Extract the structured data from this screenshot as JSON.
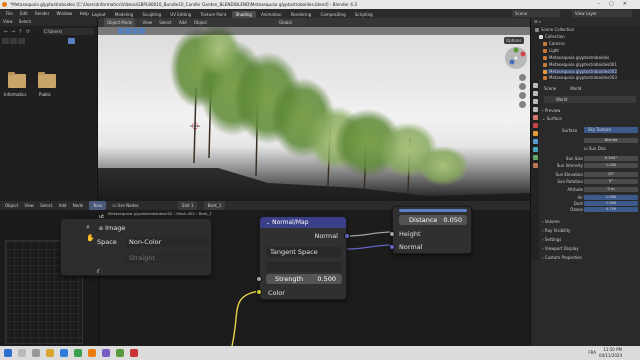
{
  "window": {
    "title": "*Metasequoia glyptostroboides [C:\\Users\\Informatics\\Videos\\GBPL80010_Bundle10_Conifer Garden_BLEND\\BLEND\\Metasequoia glyptostroboides.blend] - Blender 4.3"
  },
  "menubar": {
    "items": [
      "File",
      "Edit",
      "Render",
      "Window",
      "Help"
    ],
    "workspaces": [
      "Layout",
      "Modeling",
      "Sculpting",
      "UV Editing",
      "Texture Paint",
      "Shading",
      "Animation",
      "Rendering",
      "Compositing",
      "Scripting"
    ],
    "active_workspace": "Shading",
    "scene": "Scene",
    "view_layer": "View Layer"
  },
  "file_browser": {
    "menus": [
      "View",
      "Select"
    ],
    "path": "C:\\Users\\",
    "folders": [
      {
        "name": "Informatics"
      },
      {
        "name": "Public"
      }
    ]
  },
  "viewport": {
    "mode": "Object Mode",
    "menus": [
      "View",
      "Select",
      "Add",
      "Object"
    ],
    "orientation": "Global",
    "options": "Options"
  },
  "node_editor": {
    "menus": [
      "Object",
      "View",
      "Select",
      "Add",
      "Node"
    ],
    "new_button": "New",
    "use_nodes": "Use Nodes",
    "slot": "Slot 1",
    "material": "Bark_1",
    "breadcrumb": [
      "Metasequoia glyptostroboides002",
      "Mesh.002",
      "Bark_1"
    ],
    "image_node": {
      "title_partial": "e Image",
      "space_label": "Space",
      "space_value": "Non-Color",
      "alpha_value": "Straight",
      "pin_label": "ut",
      "r_label": "r"
    },
    "normal_map": {
      "title": "Normal/Map",
      "output": "Normal",
      "space_value": "Tangent Space",
      "uv_value": "",
      "strength_label": "Strength",
      "strength_value": "0.500",
      "color_label": "Color"
    },
    "bump_node": {
      "distance_label": "Distance",
      "distance_value": "0.050",
      "height_label": "Height",
      "normal_label": "Normal"
    }
  },
  "outliner": {
    "title": "Scene Collection",
    "items": [
      "Collection",
      "Camera",
      "Light",
      "Metasequoia glyptostroboides",
      "Metasequoia glyptostroboides001",
      "Metasequoia glyptostroboides002",
      "Metasequoia glyptostroboides003"
    ]
  },
  "properties": {
    "header_scene": "Scene",
    "header_world": "World",
    "world_name": "World",
    "preview": "Preview",
    "surface_section": "Surface",
    "surface_label": "Surface",
    "surface_value": "Sky Texture",
    "sky_type": "Nishita",
    "sun_disc": "Sun Disc",
    "fields": [
      {
        "label": "Sun Size",
        "value": "0.545°"
      },
      {
        "label": "Sun Intensity",
        "value": "1.000"
      },
      {
        "label": "Sun Elevation",
        "value": "15°"
      },
      {
        "label": "Sun Rotation",
        "value": "0°"
      },
      {
        "label": "Altitude",
        "value": "0 m"
      },
      {
        "label": "Air",
        "value": "1.000"
      },
      {
        "label": "Dust",
        "value": "1.000"
      },
      {
        "label": "Ozone",
        "value": "4.759"
      }
    ],
    "sections": [
      "Volume",
      "Ray Visibility",
      "Settings",
      "Viewport Display",
      "Custom Properties"
    ]
  },
  "taskbar": {
    "lang": "FRA",
    "time": "11:50 PM",
    "date": "04/11/2024"
  },
  "colors": {
    "accent": "#5680c2",
    "node_header_blue": "#3b3f8a",
    "socket_vector": "#6363c7",
    "socket_color": "#c7c729",
    "socket_gray": "#a1a1a1",
    "link_yellow": "#e6d34a"
  }
}
